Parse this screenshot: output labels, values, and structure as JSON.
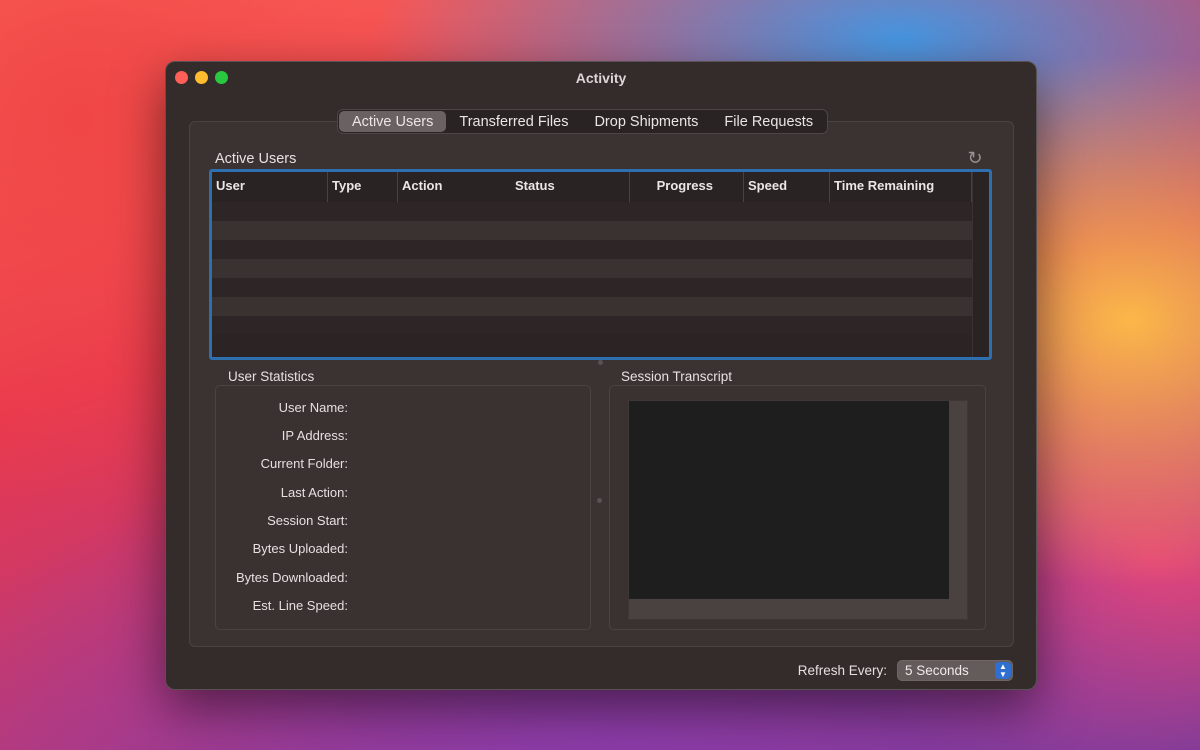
{
  "window": {
    "title": "Activity"
  },
  "tabs": [
    {
      "label": "Active Users",
      "selected": true
    },
    {
      "label": "Transferred Files",
      "selected": false
    },
    {
      "label": "Drop Shipments",
      "selected": false
    },
    {
      "label": "File Requests",
      "selected": false
    }
  ],
  "active_users": {
    "title": "Active Users",
    "refresh_icon": "refresh-icon",
    "columns": [
      "User",
      "Type",
      "Action",
      "Status",
      "Progress",
      "Speed",
      "Time Remaining"
    ],
    "rows": []
  },
  "user_statistics": {
    "title": "User Statistics",
    "fields": [
      "User Name:",
      "IP Address:",
      "Current Folder:",
      "Last Action:",
      "Session Start:",
      "Bytes Uploaded:",
      "Bytes Downloaded:",
      "Est. Line Speed:"
    ]
  },
  "session_transcript": {
    "title": "Session Transcript",
    "text": ""
  },
  "footer": {
    "refresh_label": "Refresh Every:",
    "refresh_value": "5 Seconds"
  },
  "colors": {
    "accent": "#2e6fb0",
    "select_accent": "#2f6fd1",
    "window_bg": "#342b2b"
  }
}
